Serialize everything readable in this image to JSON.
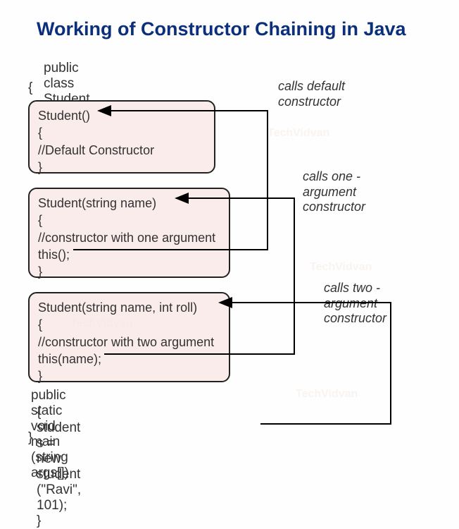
{
  "title": "Working of Constructor Chaining in Java",
  "class_decl": "public class Student",
  "brace_open": "{",
  "brace_close": "}",
  "box1": {
    "line1": "Student()",
    "line2": "{",
    "line3": "//Default Constructor",
    "line4": "}"
  },
  "box2": {
    "line1": "Student(string name)",
    "line2": "{",
    "line3": "//constructor with one argument",
    "line4": "this();",
    "line5": "}"
  },
  "box3": {
    "line1": "Student(string name, int roll)",
    "line2": "{",
    "line3": "//constructor with two argument",
    "line4": "this(name);",
    "line5": "}"
  },
  "main": {
    "decl": "public static void main (string args[])",
    "brace_open": "{",
    "body": "student s = new student (\"Ravi\", 101);",
    "brace_close": "}"
  },
  "annotations": {
    "a1_l1": "calls default",
    "a1_l2": "constructor",
    "a2_l1": "calls one -",
    "a2_l2": "argument",
    "a2_l3": "constructor",
    "a3_l1": "calls two -",
    "a3_l2": "argument",
    "a3_l3": "constructor"
  },
  "watermark": "TechVidvan"
}
